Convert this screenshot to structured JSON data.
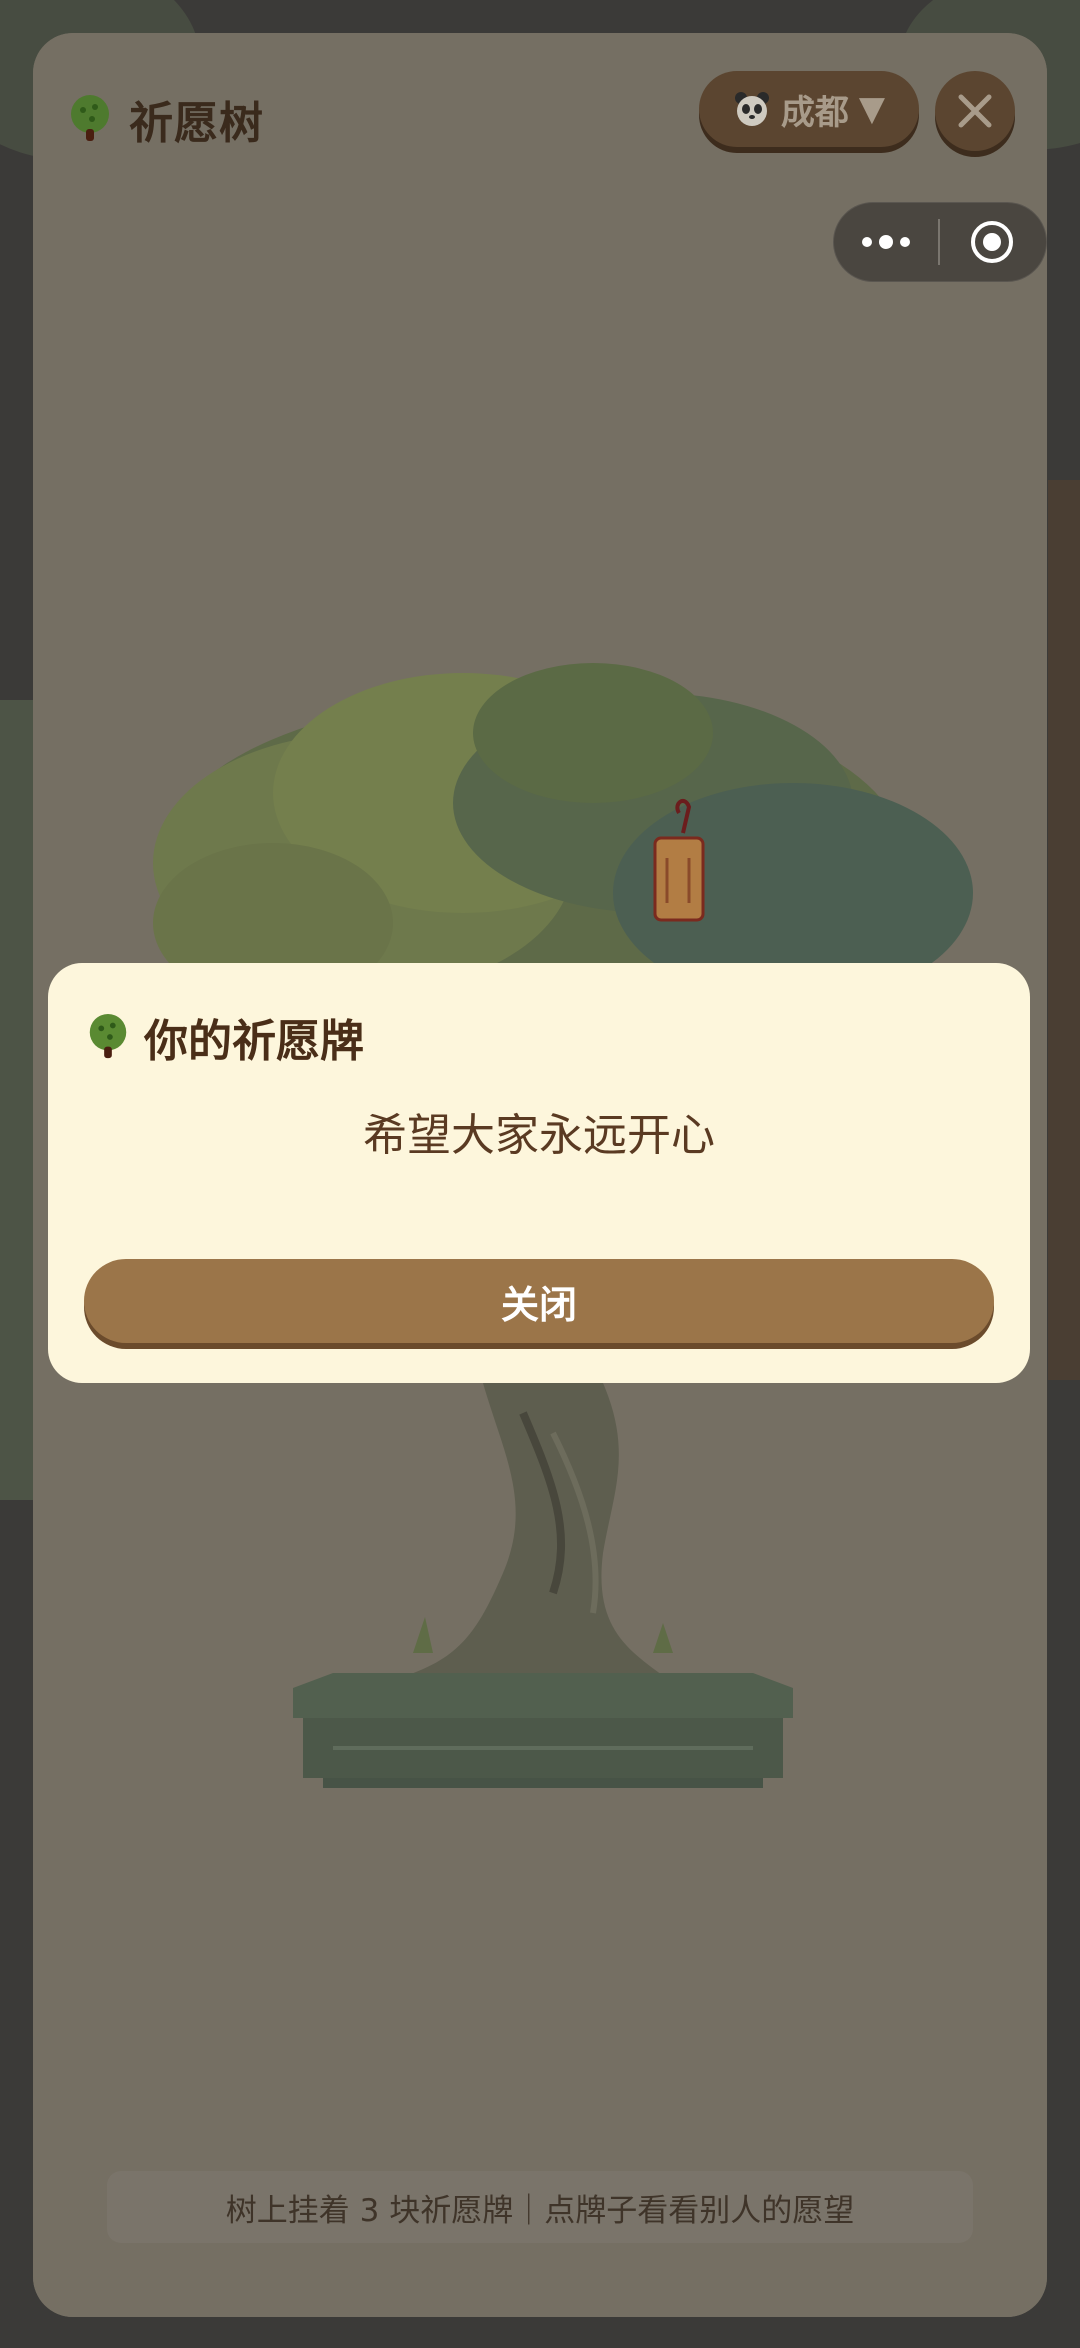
{
  "app": {
    "title": "祈愿树",
    "tree_icon": "tree-icon"
  },
  "header": {
    "city_label": "成都",
    "city_caret": "▼",
    "city_icon": "panda-icon",
    "close_icon": "close-icon"
  },
  "capsule": {
    "more_icon": "more-dots-icon",
    "target_icon": "target-icon"
  },
  "dialog": {
    "title": "你的祈愿牌",
    "wish": "希望大家永远开心",
    "close_label": "关闭"
  },
  "footer": {
    "hint": "树上挂着 3 块祈愿牌｜点牌子看看别人的愿望"
  },
  "colors": {
    "accent_brown": "#9b7549",
    "dialog_bg": "#fdf6dc",
    "title_brown": "#4a2e18",
    "overlay": "#756f63"
  }
}
